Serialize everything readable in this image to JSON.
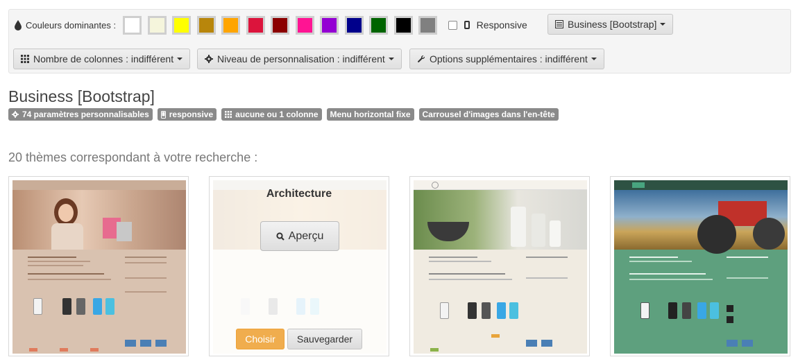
{
  "filters": {
    "colors_label": "Couleurs dominantes :",
    "colors": [
      "#ffffff",
      "#f5f5dc",
      "#ffff00",
      "#b8860b",
      "#ffa500",
      "#dc143c",
      "#8b0000",
      "#ff1493",
      "#9400d3",
      "#00008b",
      "#006400",
      "#000000",
      "#808080"
    ],
    "responsive_label": "Responsive",
    "framework_dropdown": "Business [Bootstrap]",
    "columns_dropdown": "Nombre de colonnes : indifférent",
    "customization_dropdown": "Niveau de personnalisation : indifférent",
    "options_dropdown": "Options supplémentaires : indifférent"
  },
  "theme": {
    "title": "Business [Bootstrap]",
    "tags": [
      {
        "icon": "gear-icon",
        "label": "74 paramètres personnalisables"
      },
      {
        "icon": "mobile-icon",
        "label": "responsive"
      },
      {
        "icon": "grid-icon",
        "label": "aucune ou 1 colonne"
      },
      {
        "icon": "",
        "label": "Menu horizontal fixe"
      },
      {
        "icon": "",
        "label": "Carrousel d'images dans l'en-tête"
      }
    ]
  },
  "results_text": "20 thèmes correspondant à votre recherche :",
  "cards": [
    {
      "theme_color": "#d9c2b0"
    },
    {
      "hover_title": "Architecture",
      "preview_label": "Aperçu",
      "choose_label": "Choisir",
      "save_label": "Sauvegarder",
      "theme_color": "#f6efe2"
    },
    {
      "theme_color": "#f0ebe1"
    },
    {
      "theme_color": "#5ea07e"
    }
  ],
  "colors": {
    "panel_bg": "#f5f5f5",
    "tag_bg": "#8a8a8a",
    "choose_btn": "#f0ad4e"
  }
}
